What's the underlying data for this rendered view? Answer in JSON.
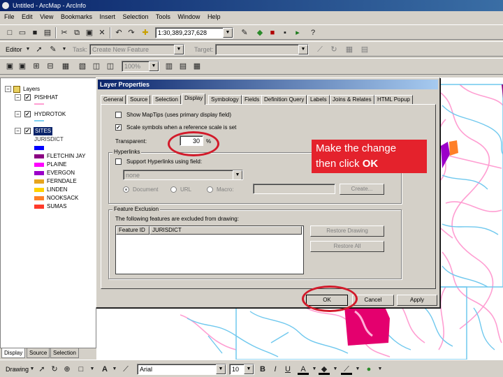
{
  "window": {
    "title": "Untitled - ArcMap - ArcInfo"
  },
  "menu": [
    "File",
    "Edit",
    "View",
    "Bookmarks",
    "Insert",
    "Selection",
    "Tools",
    "Window",
    "Help"
  ],
  "standard_toolbar": {
    "scale": "1:30,389,237,628"
  },
  "editor_toolbar": {
    "editor_label": "Editor",
    "task_label": "Task:",
    "task_value": "Create New Feature",
    "target_label": "Target:",
    "target_value": ""
  },
  "zoom_toolbar": {
    "zoom": "100%"
  },
  "toc": {
    "root": "Layers",
    "layers": [
      {
        "name": "PISHHAT",
        "checked": true
      },
      {
        "name": "HYDROTOK",
        "checked": true
      },
      {
        "name": "SITES",
        "checked": true,
        "selected": true
      }
    ],
    "legend_heading": "JURISDICT",
    "legend": [
      {
        "label": "",
        "color": "#0000ff"
      },
      {
        "label": "FLETCHIN JAY",
        "color": "#8b0082"
      },
      {
        "label": "PLAINE",
        "color": "#ff00ff"
      },
      {
        "label": "EVERGON",
        "color": "#9b00c9"
      },
      {
        "label": "FERNDALE",
        "color": "#e6a51e"
      },
      {
        "label": "LINDEN",
        "color": "#ffd200"
      },
      {
        "label": "NOOKSACK",
        "color": "#ff7f27"
      },
      {
        "label": "SUMAS",
        "color": "#ff3a2a"
      }
    ],
    "tabs": [
      "Display",
      "Source",
      "Selection"
    ]
  },
  "dialog": {
    "title": "Layer Properties",
    "tabs": [
      "General",
      "Source",
      "Selection",
      "Display",
      "Symbology",
      "Fields",
      "Definition Query",
      "Labels",
      "Joins & Relates",
      "HTML Popup"
    ],
    "active_tab": "Display",
    "show_maptips": "Show MapTips (uses primary display field)",
    "scale_symbols": "Scale symbols when a reference scale is set",
    "transparent_label": "Transparent:",
    "transparent_value": "30",
    "percent": "%",
    "hyperlinks_group": "Hyperlinks",
    "support_hyperlinks": "Support Hyperlinks using field:",
    "hyperlink_field": "none",
    "radio_options": [
      "Document",
      "URL",
      "Macro:"
    ],
    "create_button": "Create...",
    "exclusion_group": "Feature Exclusion",
    "exclusion_text": "The following features are excluded from drawing:",
    "table_headers": [
      "Feature ID",
      "JURISDICT"
    ],
    "restore_drawing": "Restore Drawing",
    "restore_all": "Restore All",
    "ok": "OK",
    "cancel": "Cancel",
    "apply": "Apply"
  },
  "drawing_toolbar": {
    "drawing_label": "Drawing",
    "font": "Arial",
    "size": "10",
    "bold": "B",
    "italic": "I",
    "underline": "U"
  },
  "callout": {
    "line1": "Make the change",
    "line2_pre": "then click ",
    "line2_bold": "OK"
  },
  "colors": {
    "accent": "#e4222c",
    "highlight": "#d21a2a",
    "titlebar": "#0a246a"
  }
}
